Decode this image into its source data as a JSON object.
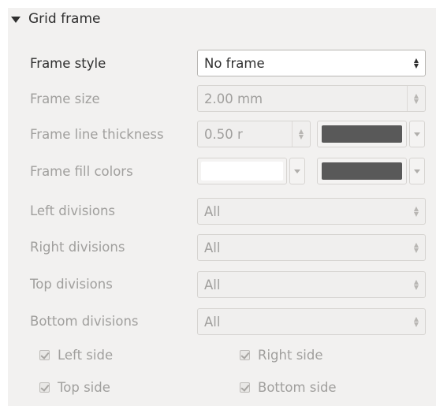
{
  "section": {
    "title": "Grid frame"
  },
  "rows": {
    "frame_style": {
      "label": "Frame style",
      "value": "No frame"
    },
    "frame_size": {
      "label": "Frame size",
      "value": "2.00 mm"
    },
    "frame_line_thickness": {
      "label": "Frame line thickness",
      "value": "0.50 r",
      "color": "#595959"
    },
    "frame_fill_colors": {
      "label": "Frame fill colors",
      "color1": "#ffffff",
      "color2": "#595959"
    },
    "left_divisions": {
      "label": "Left divisions",
      "value": "All"
    },
    "right_divisions": {
      "label": "Right divisions",
      "value": "All"
    },
    "top_divisions": {
      "label": "Top divisions",
      "value": "All"
    },
    "bottom_divisions": {
      "label": "Bottom divisions",
      "value": "All"
    }
  },
  "checkboxes": {
    "left_side": {
      "label": "Left side",
      "checked": true
    },
    "right_side": {
      "label": "Right side",
      "checked": true
    },
    "top_side": {
      "label": "Top side",
      "checked": true
    },
    "bottom_side": {
      "label": "Bottom side",
      "checked": true
    }
  },
  "icons": {
    "collapse": "triangle-down-icon",
    "spin": "spin-arrows-icon",
    "dropdown": "chevron-down-icon"
  }
}
